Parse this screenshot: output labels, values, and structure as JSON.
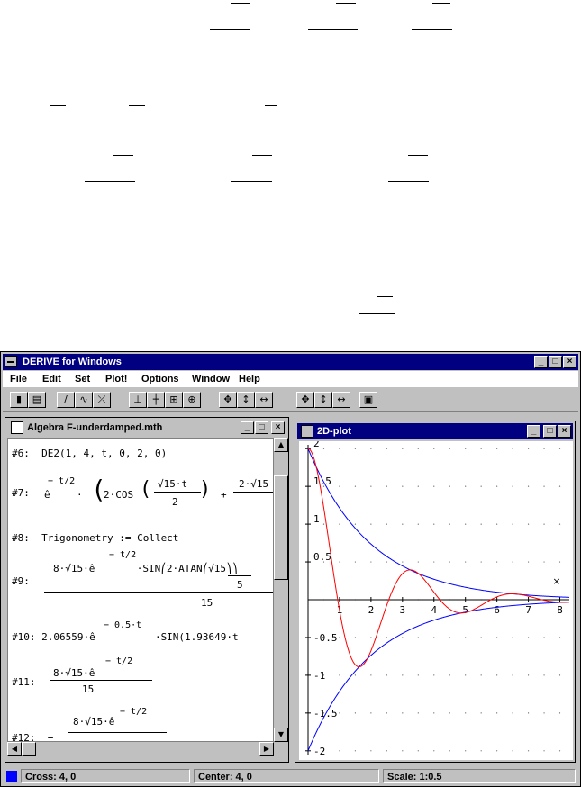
{
  "window": {
    "title": "DERIVE for Windows",
    "minimize_glyph": "_",
    "maximize_glyph": "□",
    "close_glyph": "×"
  },
  "menu": [
    "File",
    "Edit",
    "Set",
    "Plot!",
    "Options",
    "Window",
    "Help"
  ],
  "toolbar_icons": [
    "open-icon",
    "print-icon",
    "author-icon",
    "simplify-icon",
    "plot-icon",
    "axes-icon",
    "crosshair-icon",
    "zoom-box-icon",
    "center-icon",
    "zoom-in-icon",
    "zoom-vertical-icon",
    "zoom-horizontal-icon",
    "zoom-out-icon",
    "zoom-out-vertical-icon",
    "zoom-out-horizontal-icon",
    "window-icon"
  ],
  "algebra": {
    "title": "Algebra  F-underdamped.mth",
    "lines": {
      "l6": "#6:  DE2(1, 4, t, 0, 2, 0)",
      "l7_label": "#7:",
      "l7_body": "ê       · ⎛2·COS⎛ √15·t ⎞  +  ",
      "l7_sup": "− t/2",
      "l7_num": "√15·t",
      "l7_den": "2",
      "l7_tail": "2·√15",
      "l8": "#8:  Trigonometry := Collect",
      "l9_label": "#9:",
      "l9_num": "8·√15·ê       ·SIN⎛2·ATAN⎛√15⎞⎞",
      "l9_sup": "− t/2",
      "l9_inner_den": "5",
      "l9_den": "15",
      "l10": "#10: 2.06559·ê          ·SIN(1.93649·t",
      "l10_sup": "− 0.5·t",
      "l11_label": "#11:",
      "l11_num": "8·√15·ê",
      "l11_sup": "− t/2",
      "l11_den": "15",
      "l12_label": "#12:  −",
      "l12_num": "8·√15·ê",
      "l12_sup": "− t/2"
    }
  },
  "plot": {
    "title": "2D-plot",
    "x_ticks": [
      "1",
      "2",
      "3",
      "4",
      "5",
      "6",
      "7",
      "8"
    ],
    "y_ticks": [
      "2",
      "1.5",
      "1",
      "0.5",
      "-0.5",
      "-1",
      "-1.5",
      "-2"
    ],
    "cross_marker": "×",
    "curve_color": "#ff0000",
    "envelope_color": "#0000ff",
    "x_range": [
      0,
      8.3
    ],
    "y_range": [
      -2.05,
      2.05
    ]
  },
  "status": {
    "cross": "Cross: 4, 0",
    "center": "Center: 4, 0",
    "scale": "Scale: 1:0.5"
  }
}
